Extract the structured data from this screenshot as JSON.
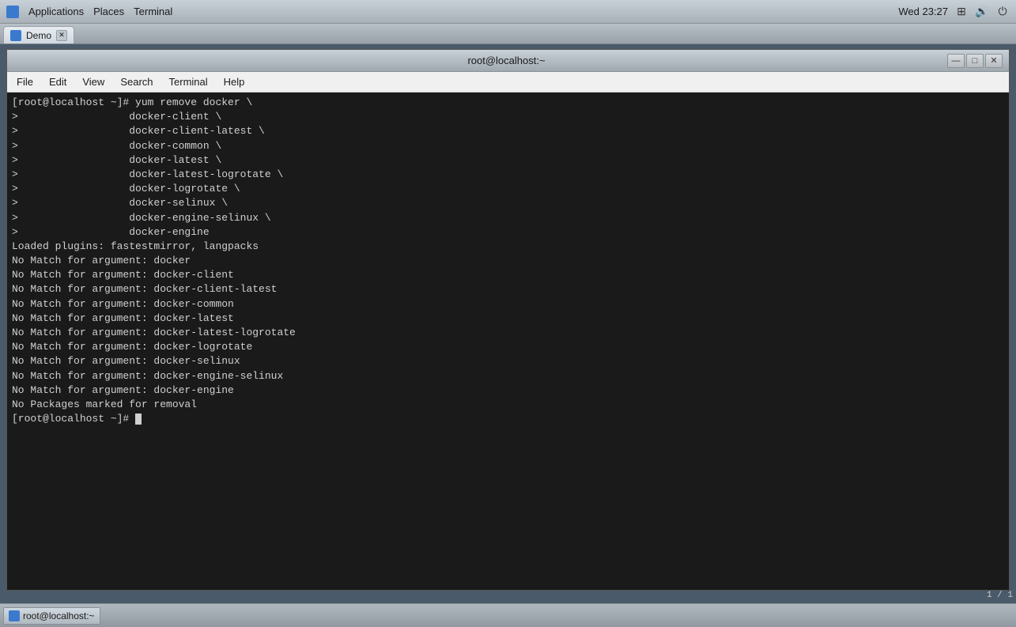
{
  "taskbar": {
    "tab_label": "Demo",
    "apps_label": "Applications",
    "places_label": "Places",
    "terminal_label": "Terminal",
    "time": "Wed 23:27"
  },
  "terminal": {
    "title": "root@localhost:~",
    "menu": {
      "file": "File",
      "edit": "Edit",
      "view": "View",
      "search": "Search",
      "terminal": "Terminal",
      "help": "Help"
    },
    "content_lines": [
      "[root@localhost ~]# yum remove docker \\",
      ">                  docker-client \\",
      ">                  docker-client-latest \\",
      ">                  docker-common \\",
      ">                  docker-latest \\",
      ">                  docker-latest-logrotate \\",
      ">                  docker-logrotate \\",
      ">                  docker-selinux \\",
      ">                  docker-engine-selinux \\",
      ">                  docker-engine",
      "Loaded plugins: fastestmirror, langpacks",
      "No Match for argument: docker",
      "No Match for argument: docker-client",
      "No Match for argument: docker-client-latest",
      "No Match for argument: docker-common",
      "No Match for argument: docker-latest",
      "No Match for argument: docker-latest-logrotate",
      "No Match for argument: docker-logrotate",
      "No Match for argument: docker-selinux",
      "No Match for argument: docker-engine-selinux",
      "No Match for argument: docker-engine",
      "No Packages marked for removal",
      "[root@localhost ~]# "
    ]
  },
  "bottom_taskbar": {
    "tab_label": "root@localhost:~"
  },
  "win_buttons": {
    "minimize": "—",
    "maximize": "□",
    "close": "✕"
  },
  "page_indicator": "1 / 1"
}
